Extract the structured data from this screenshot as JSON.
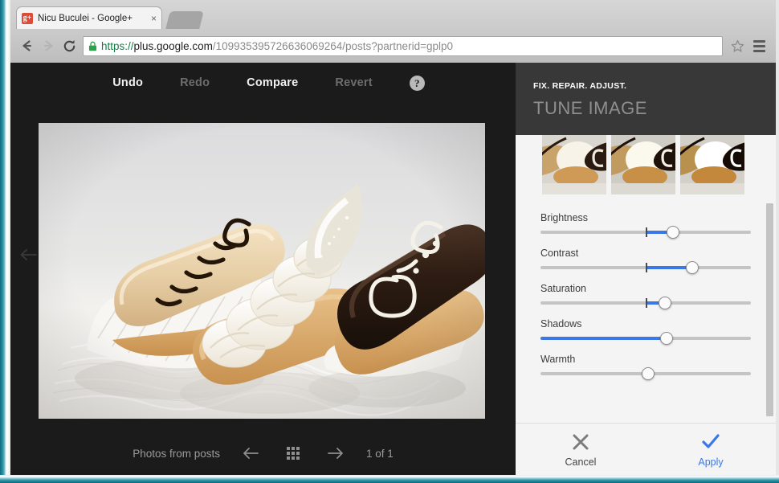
{
  "browser": {
    "tab": {
      "favicon_text": "g+",
      "favicon_name": "google-plus-favicon",
      "title": "Nicu Buculei - Google+",
      "close_glyph": "×"
    },
    "url": {
      "scheme": "https://",
      "host": "plus.google.com",
      "path": "/109935395726636069264/posts?partnerid=gplp0",
      "full": "https://plus.google.com/109935395726636069264/posts?partnerid=gplp0"
    },
    "icons": {
      "back": "back-arrow-icon",
      "forward": "forward-arrow-icon",
      "reload": "reload-icon",
      "lock": "ssl-lock-icon",
      "bookmark": "star-icon",
      "menu": "hamburger-menu-icon"
    }
  },
  "editor": {
    "toolbar": [
      {
        "label": "Undo",
        "enabled": true
      },
      {
        "label": "Redo",
        "enabled": false
      },
      {
        "label": "Compare",
        "enabled": true
      },
      {
        "label": "Revert",
        "enabled": false
      }
    ],
    "help_glyph": "?",
    "back_icon": "back-arrow-icon",
    "footer": {
      "label": "Photos from posts",
      "prev_icon": "arrow-left-icon",
      "grid_icon": "grid-view-icon",
      "next_icon": "arrow-right-icon",
      "count": "1 of 1"
    }
  },
  "panel": {
    "kicker": "FIX. REPAIR. ADJUST.",
    "title": "TUNE IMAGE",
    "thumbnails": [
      {
        "name": "preset-thumbnail-1"
      },
      {
        "name": "preset-thumbnail-2"
      },
      {
        "name": "preset-thumbnail-3"
      }
    ],
    "sliders": [
      {
        "label": "Brightness",
        "value": 63,
        "notch": 50,
        "fill_from": 50,
        "has_notch": true
      },
      {
        "label": "Contrast",
        "value": 72,
        "notch": 50,
        "fill_from": 50,
        "has_notch": true
      },
      {
        "label": "Saturation",
        "value": 59,
        "notch": 50,
        "fill_from": 50,
        "has_notch": true
      },
      {
        "label": "Shadows",
        "value": 60,
        "notch": 0,
        "fill_from": 0,
        "has_notch": false
      },
      {
        "label": "Warmth",
        "value": 51,
        "notch": 0,
        "fill_from": 51,
        "has_notch": false
      }
    ],
    "footer": {
      "cancel_label": "Cancel",
      "cancel_icon": "close-x-icon",
      "apply_label": "Apply",
      "apply_icon": "checkmark-icon"
    },
    "colors": {
      "accent": "#3b78e7",
      "track": "#c4c4c4",
      "panel_bg": "#f4f4f4",
      "header_bg": "#383838",
      "app_bg": "#1b1b1b"
    }
  }
}
